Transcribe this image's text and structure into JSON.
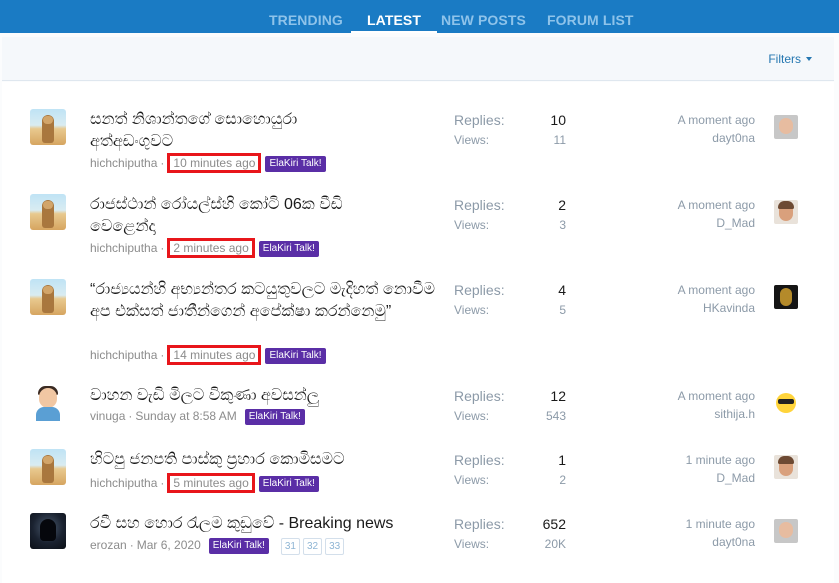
{
  "nav": {
    "tabs": [
      {
        "label": "TRENDING"
      },
      {
        "label": "LATEST"
      },
      {
        "label": "NEW POSTS"
      },
      {
        "label": "FORUM LIST"
      }
    ]
  },
  "filters": {
    "label": "Filters"
  },
  "stats_labels": {
    "replies": "Replies:",
    "views": "Views:"
  },
  "threads": [
    {
      "title": "සනත් නිශාන්තගේ සොහොයුරා අත්අඩංගුවට",
      "author": "hichchiputha",
      "time": "10 minutes ago",
      "forum": "ElaKiri Talk!",
      "replies": "10",
      "views": "11",
      "last_time": "A moment ago",
      "last_user": "dayt0na"
    },
    {
      "title": "රාජස්ථාන් රෝයල්ස්හි කෝටි 06ක වීඩි වෙළෙන්දා",
      "author": "hichchiputha",
      "time": "2 minutes ago",
      "forum": "ElaKiri Talk!",
      "replies": "2",
      "views": "3",
      "last_time": "A moment ago",
      "last_user": "D_Mad"
    },
    {
      "title": "“රාජ්‍යයන්හි අභ්‍යන්තර කටයුතුවලට මැදිහත් නොවීම අප එක්සත් ජාතීන්ගෙන් අපේක්ෂා කරන්නෙමු”",
      "author": "hichchiputha",
      "time": "14 minutes ago",
      "forum": "ElaKiri Talk!",
      "replies": "4",
      "views": "5",
      "last_time": "A moment ago",
      "last_user": "HKavinda"
    },
    {
      "title": "වාහන වැඩි මිලට විකුණා අවසන්ලු",
      "author": "vinuga",
      "time": "Sunday at 8:58 AM",
      "forum": "ElaKiri Talk!",
      "replies": "12",
      "views": "543",
      "last_time": "A moment ago",
      "last_user": "sithija.h"
    },
    {
      "title": "හිටපු ජනපති පාස්කු ප්‍රහාර කොමිසමට",
      "author": "hichchiputha",
      "time": "5 minutes ago",
      "forum": "ElaKiri Talk!",
      "replies": "1",
      "views": "2",
      "last_time": "1 minute ago",
      "last_user": "D_Mad"
    },
    {
      "title": "රවී සහ හොර රැලම කුඩුවේ - Breaking news",
      "author": "erozan",
      "time": "Mar 6, 2020",
      "forum": "ElaKiri Talk!",
      "pages": [
        "31",
        "32",
        "33"
      ],
      "replies": "652",
      "views": "20K",
      "last_time": "1 minute ago",
      "last_user": "dayt0na"
    }
  ]
}
